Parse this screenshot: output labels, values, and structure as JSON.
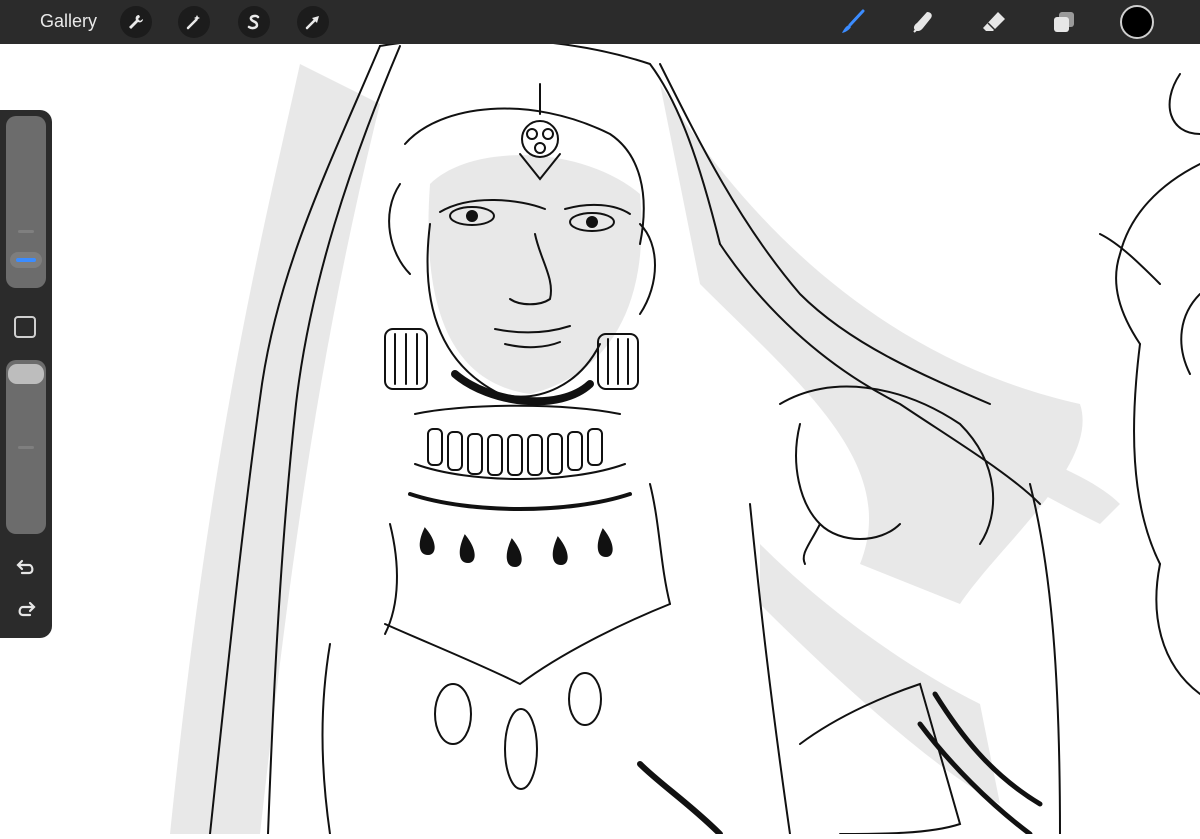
{
  "toolbar": {
    "gallery_label": "Gallery",
    "left_tools": [
      {
        "name": "actions-wrench-icon"
      },
      {
        "name": "adjustments-magic-wand-icon"
      },
      {
        "name": "selection-s-icon"
      },
      {
        "name": "transform-arrow-icon"
      }
    ],
    "right_tools": [
      {
        "name": "brush-icon",
        "active": true
      },
      {
        "name": "smudge-icon"
      },
      {
        "name": "eraser-icon"
      },
      {
        "name": "layers-icon"
      }
    ],
    "active_color": "#000000",
    "accent_color": "#3b8cff"
  },
  "sidebar": {
    "brush_size_level": 0.55,
    "opacity_level": 0.98,
    "icons": [
      "modify-square-icon",
      "undo-icon",
      "redo-icon"
    ]
  }
}
